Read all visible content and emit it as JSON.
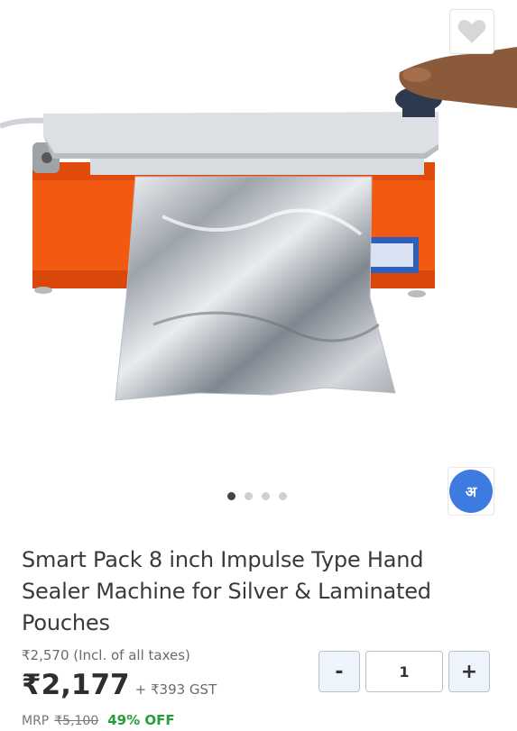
{
  "product": {
    "title": "Smart Pack 8 inch Impulse Type Hand Sealer Machine for Silver & Laminated Pouches",
    "incl_price": "₹2,570 (Incl. of all taxes)",
    "price": "₹2,177",
    "gst": "+ ₹393 GST",
    "mrp_label": "MRP",
    "mrp_value": "₹5,100",
    "discount": "49% OFF"
  },
  "quantity": {
    "minus_label": "-",
    "value": "1",
    "plus_label": "+"
  },
  "carousel": {
    "count": 4,
    "active": 0
  },
  "language_button": {
    "label": "अ"
  },
  "icons": {
    "wishlist": "heart-icon"
  },
  "colors": {
    "accent_blue": "#3d7be0",
    "discount_green": "#2a9c3a",
    "machine_orange": "#f25a12"
  }
}
